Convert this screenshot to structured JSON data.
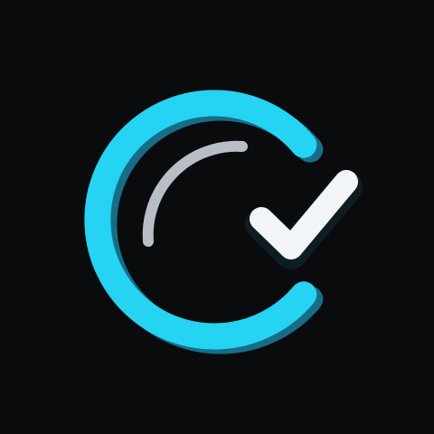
{
  "icon": {
    "name": "check-circle-logo-icon",
    "background_color": "#0a0b0d",
    "ring_color": "#25d3f2",
    "ring_shadow_color": "#176d87",
    "inner_arc_color": "#b7bec6",
    "check_color": "#f2f5f7",
    "check_shadow_color": "#0e1c24"
  }
}
